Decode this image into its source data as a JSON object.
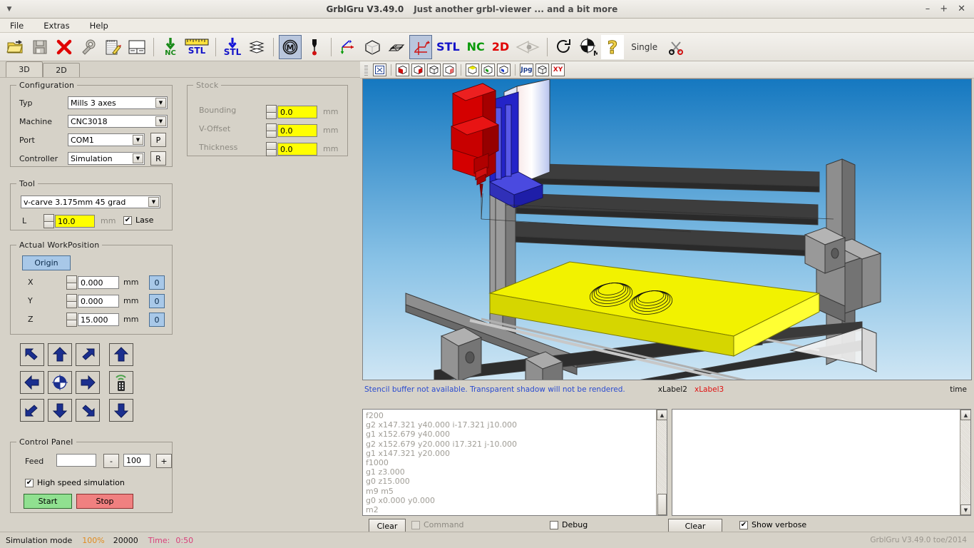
{
  "window": {
    "app_title": "GrblGru V3.49.0",
    "subtitle": "Just another grbl-viewer ... and a bit more",
    "minimize": "–",
    "maximize": "+",
    "close": "✕"
  },
  "menubar": {
    "items": [
      "File",
      "Extras",
      "Help"
    ]
  },
  "toolbar": {
    "items": [
      {
        "name": "open-file-icon",
        "label": ""
      },
      {
        "name": "save-file-icon",
        "label": ""
      },
      {
        "name": "close-delete-icon",
        "label": ""
      },
      {
        "name": "settings-wrench-icon",
        "label": ""
      },
      {
        "name": "editor-notepad-icon",
        "label": ""
      },
      {
        "name": "panel-layout-icon",
        "label": ""
      },
      {
        "name": "import-nc-icon",
        "label": "NC"
      },
      {
        "name": "measure-stl-icon",
        "label": "STL"
      },
      {
        "name": "import-stl-icon",
        "label": "STL"
      },
      {
        "name": "layers-icon",
        "label": ""
      },
      {
        "name": "machine-icon",
        "label": ""
      },
      {
        "name": "probe-icon",
        "label": ""
      },
      {
        "name": "axis-origin-icon",
        "label": ""
      },
      {
        "name": "cube-wireframe-icon",
        "label": ""
      },
      {
        "name": "plane-grid-icon",
        "label": ""
      },
      {
        "name": "toolpath-axis-icon",
        "label": ""
      },
      {
        "name": "stl-view-toggle",
        "label": "STL"
      },
      {
        "name": "nc-view-toggle",
        "label": "NC"
      },
      {
        "name": "2d-view-toggle",
        "label": "2D"
      },
      {
        "name": "view-eye-icon",
        "label": ""
      },
      {
        "name": "reset-rotate-icon",
        "label": ""
      },
      {
        "name": "machine-origin-icon",
        "label": "M"
      },
      {
        "name": "help-question-icon",
        "label": ""
      },
      {
        "name": "single-step-label",
        "label": "Single"
      },
      {
        "name": "scissors-cut-icon",
        "label": ""
      }
    ],
    "label_stl": "STL",
    "label_nc": "NC",
    "label_2d": "2D",
    "label_single": "Single",
    "label_nc_small": "NC",
    "label_stl_small": "STL",
    "selected_machine_icon": "machine-icon",
    "selected_toolpath_icon": "toolpath-axis-icon"
  },
  "tabs": [
    {
      "label": "3D",
      "active": true
    },
    {
      "label": "2D",
      "active": false
    }
  ],
  "configuration": {
    "legend": "Configuration",
    "rows": [
      {
        "label": "Typ",
        "value": "Mills 3 axes"
      },
      {
        "label": "Machine",
        "value": "CNC3018"
      },
      {
        "label": "Port",
        "value": "COM1"
      },
      {
        "label": "Controller",
        "value": "Simulation"
      }
    ],
    "port_button": "P",
    "controller_button": "R"
  },
  "stock": {
    "legend": "Stock",
    "rows": [
      {
        "label": "Bounding",
        "value": "0.0",
        "unit": "mm"
      },
      {
        "label": "V-Offset",
        "value": "0.0",
        "unit": "mm"
      },
      {
        "label": "Thickness",
        "value": "0.0",
        "unit": "mm"
      }
    ]
  },
  "tool": {
    "legend": "Tool",
    "selected": "v-carve 3.175mm 45 grad",
    "length_label": "L",
    "length_value": "10.0",
    "unit": "mm",
    "lase_label": "Lase",
    "lase_checked": true
  },
  "work_position": {
    "legend": "Actual WorkPosition",
    "origin_button": "Origin",
    "axes": [
      {
        "label": "X",
        "value": "0.000",
        "unit": "mm",
        "zero": "0"
      },
      {
        "label": "Y",
        "value": "0.000",
        "unit": "mm",
        "zero": "0"
      },
      {
        "label": "Z",
        "value": "15.000",
        "unit": "mm",
        "zero": "0"
      }
    ]
  },
  "jog_grid": [
    [
      "jog-xy-up-left",
      "jog-y-plus",
      "jog-xy-up-right",
      "jog-z-plus"
    ],
    [
      "jog-x-minus",
      "jog-home-center",
      "jog-x-plus",
      "jog-remote-pad"
    ],
    [
      "jog-xy-down-left",
      "jog-y-minus",
      "jog-xy-down-right",
      "jog-z-minus"
    ]
  ],
  "control_panel": {
    "legend": "Control Panel",
    "feed_label": "Feed",
    "feed_value": "",
    "feed_placeholder": "",
    "minus": "-",
    "percent": "100",
    "plus": "+",
    "highspeed_label": "High speed simulation",
    "highspeed_checked": true,
    "start": "Start",
    "stop": "Stop"
  },
  "view_toolbar": {
    "buttons": [
      "view-fit-icon",
      "view-front-red-icon",
      "view-back-red-icon",
      "view-left-white-icon",
      "view-right-white-icon",
      "view-top-yellow-icon",
      "view-iso-green-icon",
      "view-bottom-blue-icon",
      "export-jpg-icon",
      "view-perspective-icon",
      "view-xy-icon"
    ],
    "jpg_label": "Jpg",
    "xy_label": "XY"
  },
  "viewport_status": {
    "stencil_message": "Stencil buffer not available. Transparent shadow will not be rendered.",
    "xlabel2": "xLabel2",
    "xlabel3": "xLabel3",
    "time_label": "time"
  },
  "gcode_panel": {
    "lines": [
      "f200",
      "g2 x147.321 y40.000 i-17.321 j10.000",
      "g1 x152.679 y40.000",
      "g2 x152.679 y20.000 i17.321 j-10.000",
      "g1 x147.321 y20.000",
      "f1000",
      "g1 z3.000",
      "g0 z15.000",
      "m9 m5",
      "g0 x0.000 y0.000",
      "m2"
    ],
    "clear_button": "Clear",
    "command_label": "Command",
    "command_checked": false,
    "command_disabled": true,
    "debug_label": "Debug",
    "debug_checked": false
  },
  "console_panel": {
    "lines": [],
    "clear_button": "Clear",
    "verbose_label": "Show verbose",
    "verbose_checked": true
  },
  "statusbar": {
    "mode": "Simulation mode",
    "percent": "100%",
    "number": "20000",
    "time_label": "Time:",
    "time_value": "0:50",
    "version": "GrblGru V3.49.0 toe/2014"
  },
  "colors": {
    "window_bg": "#d6d2c8",
    "accent_blue": "#a8c8e8",
    "start_green": "#90e090",
    "stop_red": "#f08080",
    "yellow_field": "#ffff00",
    "stock_yellow": "#f2f200",
    "spindle_red": "#d00000",
    "spindle_blue": "#2020c8",
    "frame_gray": "#808080",
    "sky_top": "#1b7fc4",
    "sky_bottom": "#cfe6f4"
  }
}
